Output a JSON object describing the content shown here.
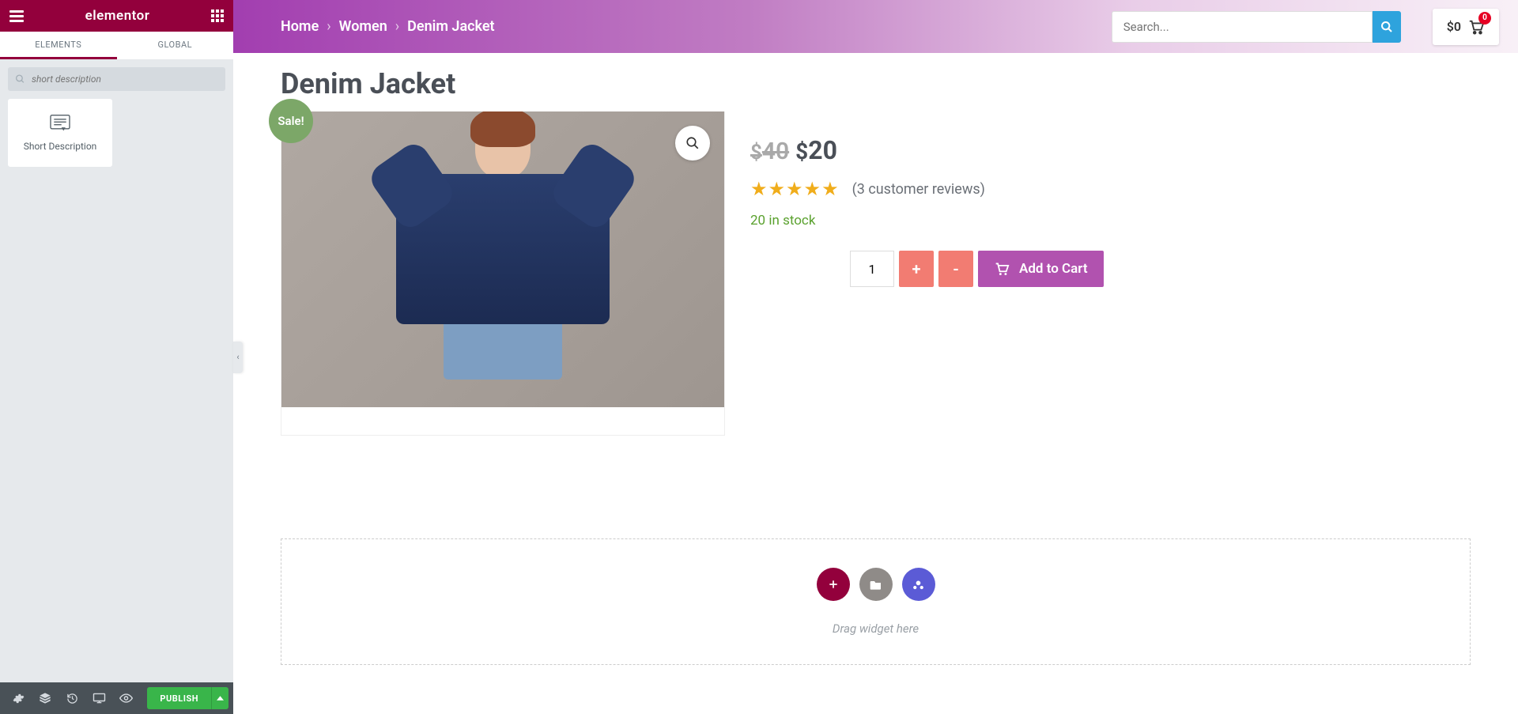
{
  "editor": {
    "logo": "elementor",
    "tabs": {
      "elements": "ELEMENTS",
      "global": "GLOBAL"
    },
    "active_tab": "elements",
    "search_placeholder": "short description",
    "widgets": [
      {
        "id": "short-description",
        "label": "Short Description"
      }
    ],
    "bottom": {
      "publish_label": "PUBLISH"
    }
  },
  "site": {
    "breadcrumb": {
      "home": "Home",
      "women": "Women",
      "current": "Denim Jacket"
    },
    "search_placeholder": "Search...",
    "cart": {
      "total": "$0",
      "count": "0"
    }
  },
  "product": {
    "title": "Denim Jacket",
    "sale_label": "Sale!",
    "old_currency": "$",
    "old_price": "40",
    "new_currency": "$",
    "new_price": "20",
    "reviews_text": "(3 customer reviews)",
    "stock_text": "20 in stock",
    "qty": "1",
    "plus_label": "+",
    "minus_label": "-",
    "add_to_cart": "Add to Cart"
  },
  "dropzone": {
    "hint": "Drag widget here"
  }
}
